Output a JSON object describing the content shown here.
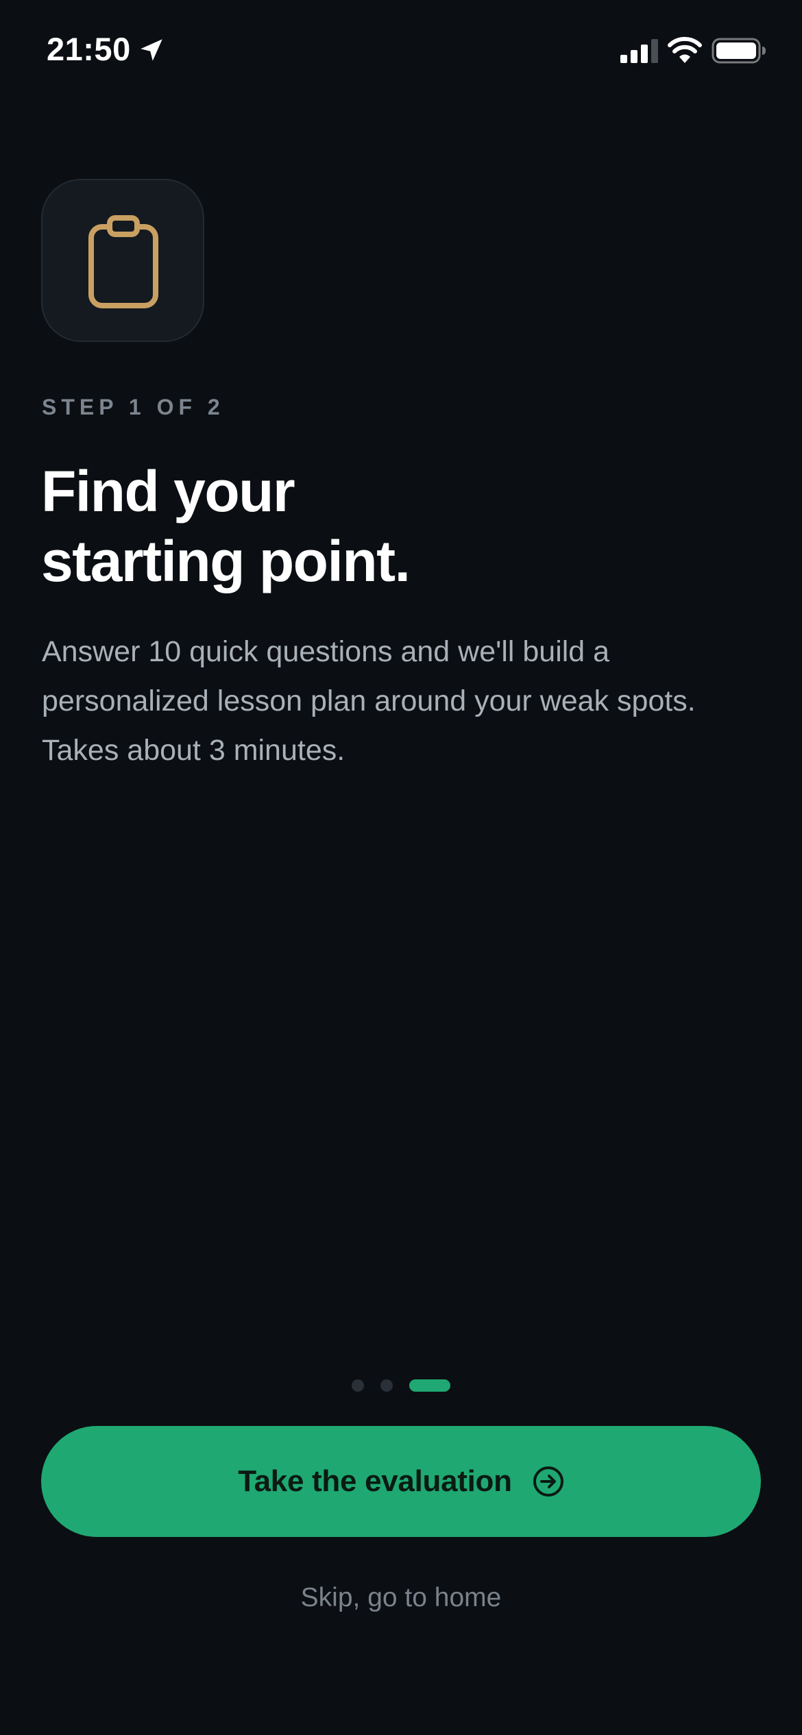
{
  "status_bar": {
    "time": "21:50",
    "icons": [
      "location-arrow-icon",
      "cellular-signal-icon",
      "wifi-icon",
      "battery-icon"
    ]
  },
  "hero": {
    "icon": "clipboard-icon",
    "icon_color": "#c9a062",
    "step_label": "STEP 1 OF 2",
    "title_lines": [
      "Find your",
      "starting point."
    ],
    "description_lines": [
      "Answer 10 quick questions and we'll build a",
      "personalized lesson plan around your weak spots.",
      "Takes about 3 minutes."
    ]
  },
  "pager": {
    "total": 3,
    "active_index": 2
  },
  "primary_action": {
    "label": "Take the evaluation",
    "icon": "arrow-right-circle-icon"
  },
  "secondary_action": {
    "label": "Skip, go to home"
  },
  "colors": {
    "background": "#0b0e12",
    "accent": "#1fa872",
    "muted_text": "#a9b0b8"
  }
}
